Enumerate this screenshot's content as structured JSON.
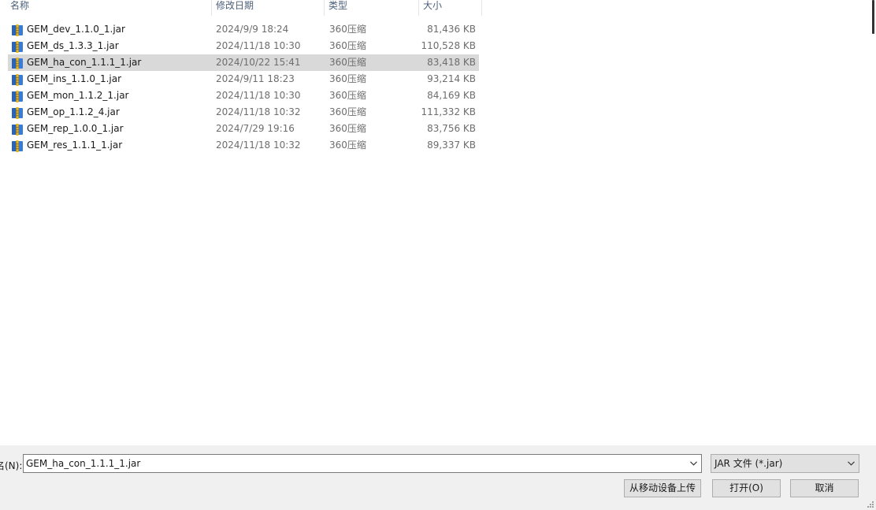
{
  "columns": {
    "name": "名称",
    "date": "修改日期",
    "type": "类型",
    "size": "大小"
  },
  "files": [
    {
      "name": "GEM_dev_1.1.0_1.jar",
      "date": "2024/9/9 18:24",
      "type": "360压缩",
      "size": "81,436 KB",
      "icon": "archive-icon",
      "selected": false
    },
    {
      "name": "GEM_ds_1.3.3_1.jar",
      "date": "2024/11/18 10:30",
      "type": "360压缩",
      "size": "110,528 KB",
      "icon": "archive-icon",
      "selected": false
    },
    {
      "name": "GEM_ha_con_1.1.1_1.jar",
      "date": "2024/10/22 15:41",
      "type": "360压缩",
      "size": "83,418 KB",
      "icon": "archive-icon",
      "selected": true
    },
    {
      "name": "GEM_ins_1.1.0_1.jar",
      "date": "2024/9/11 18:23",
      "type": "360压缩",
      "size": "93,214 KB",
      "icon": "archive-icon",
      "selected": false
    },
    {
      "name": "GEM_mon_1.1.2_1.jar",
      "date": "2024/11/18 10:30",
      "type": "360压缩",
      "size": "84,169 KB",
      "icon": "archive-icon",
      "selected": false
    },
    {
      "name": "GEM_op_1.1.2_4.jar",
      "date": "2024/11/18 10:32",
      "type": "360压缩",
      "size": "111,332 KB",
      "icon": "archive-icon",
      "selected": false
    },
    {
      "name": "GEM_rep_1.0.0_1.jar",
      "date": "2024/7/29 19:16",
      "type": "360压缩",
      "size": "83,756 KB",
      "icon": "archive-icon",
      "selected": false
    },
    {
      "name": "GEM_res_1.1.1_1.jar",
      "date": "2024/11/18 10:32",
      "type": "360压缩",
      "size": "89,337 KB",
      "icon": "archive-icon",
      "selected": false
    }
  ],
  "bottom": {
    "filename_label": "名(N):",
    "filename_value": "GEM_ha_con_1.1.1_1.jar",
    "filetype_value": "JAR 文件 (*.jar)",
    "upload_label": "从移动设备上传",
    "open_label": "打开(O)",
    "cancel_label": "取消"
  },
  "colors": {
    "selected_row": "#d9d9d9",
    "header_text": "#4c607a",
    "panel_bg": "#f0f0f0",
    "button_bg": "#e1e1e1"
  }
}
